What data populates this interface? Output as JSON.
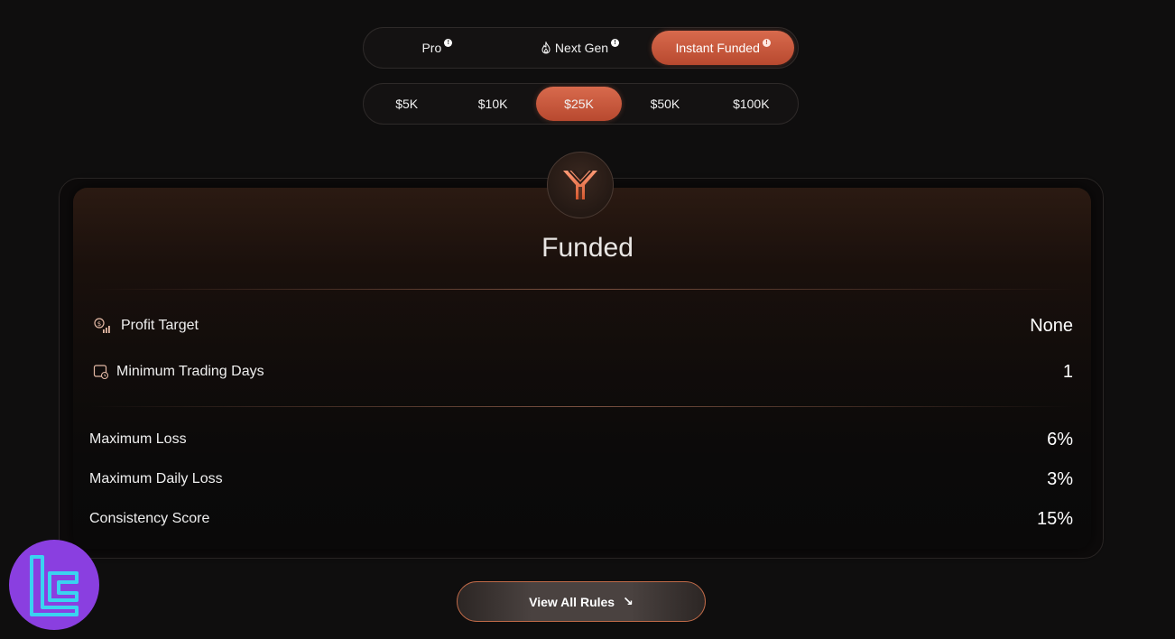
{
  "program_tabs": [
    {
      "label": "Pro",
      "icon": "",
      "active": false
    },
    {
      "label": "Next Gen",
      "icon": "flame-icon",
      "active": false
    },
    {
      "label": "Instant Funded",
      "icon": "",
      "active": true
    }
  ],
  "info_symbol": "!",
  "account_sizes": [
    {
      "label": "$5K",
      "active": false
    },
    {
      "label": "$10K",
      "active": false
    },
    {
      "label": "$25K",
      "active": true
    },
    {
      "label": "$50K",
      "active": false
    },
    {
      "label": "$100K",
      "active": false
    }
  ],
  "card": {
    "title": "Funded",
    "primary_rows": [
      {
        "label": "Profit Target",
        "value": "None",
        "icon": "profit-target-icon"
      },
      {
        "label": "Minimum Trading Days",
        "value": "1",
        "icon": "calendar-clock-icon"
      }
    ],
    "secondary_rows": [
      {
        "label": "Maximum Loss",
        "value": "6%"
      },
      {
        "label": "Maximum Daily Loss",
        "value": "3%"
      },
      {
        "label": "Consistency Score",
        "value": "15%"
      }
    ]
  },
  "view_rules_button": {
    "label": "View All Rules",
    "icon": "arrow-down-right-icon",
    "arrow": "↘"
  },
  "colors": {
    "accent": "#c9583b",
    "background": "#0f0e0e",
    "watermark": "#8a3fe0"
  }
}
